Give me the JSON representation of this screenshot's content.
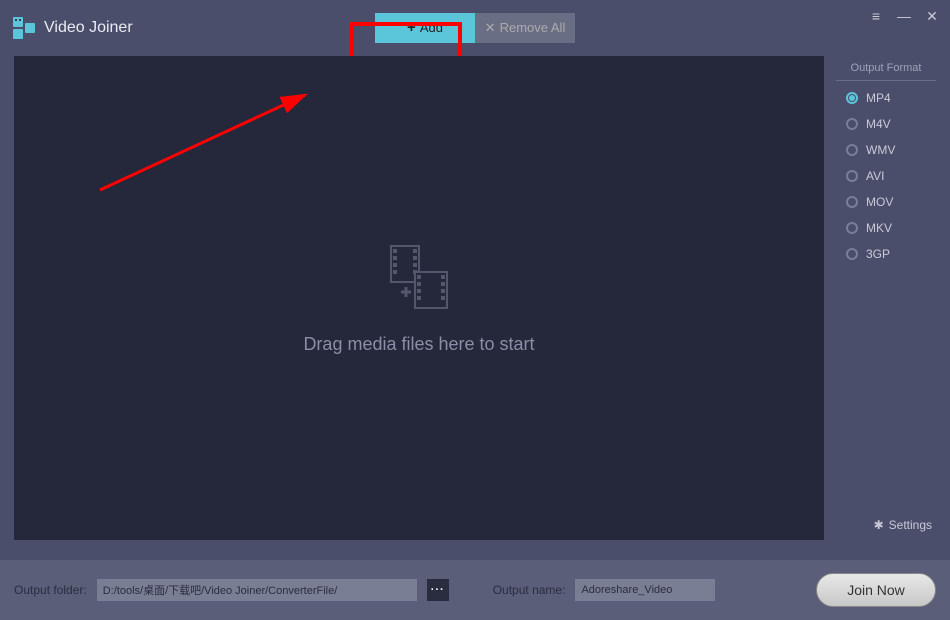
{
  "app": {
    "title": "Video Joiner"
  },
  "toolbar": {
    "add_label": "Add",
    "remove_label": "Remove All"
  },
  "dropzone": {
    "hint": "Drag media files here to start"
  },
  "sidebar": {
    "title": "Output Format",
    "formats": [
      "MP4",
      "M4V",
      "WMV",
      "AVI",
      "MOV",
      "MKV",
      "3GP"
    ],
    "selected": "MP4",
    "settings_label": "Settings"
  },
  "footer": {
    "output_folder_label": "Output folder:",
    "output_folder_value": "D:/tools/桌面/下载吧/Video Joiner/ConverterFile/",
    "browse_label": "···",
    "output_name_label": "Output name:",
    "output_name_value": "Adoreshare_Video",
    "join_label": "Join Now"
  }
}
